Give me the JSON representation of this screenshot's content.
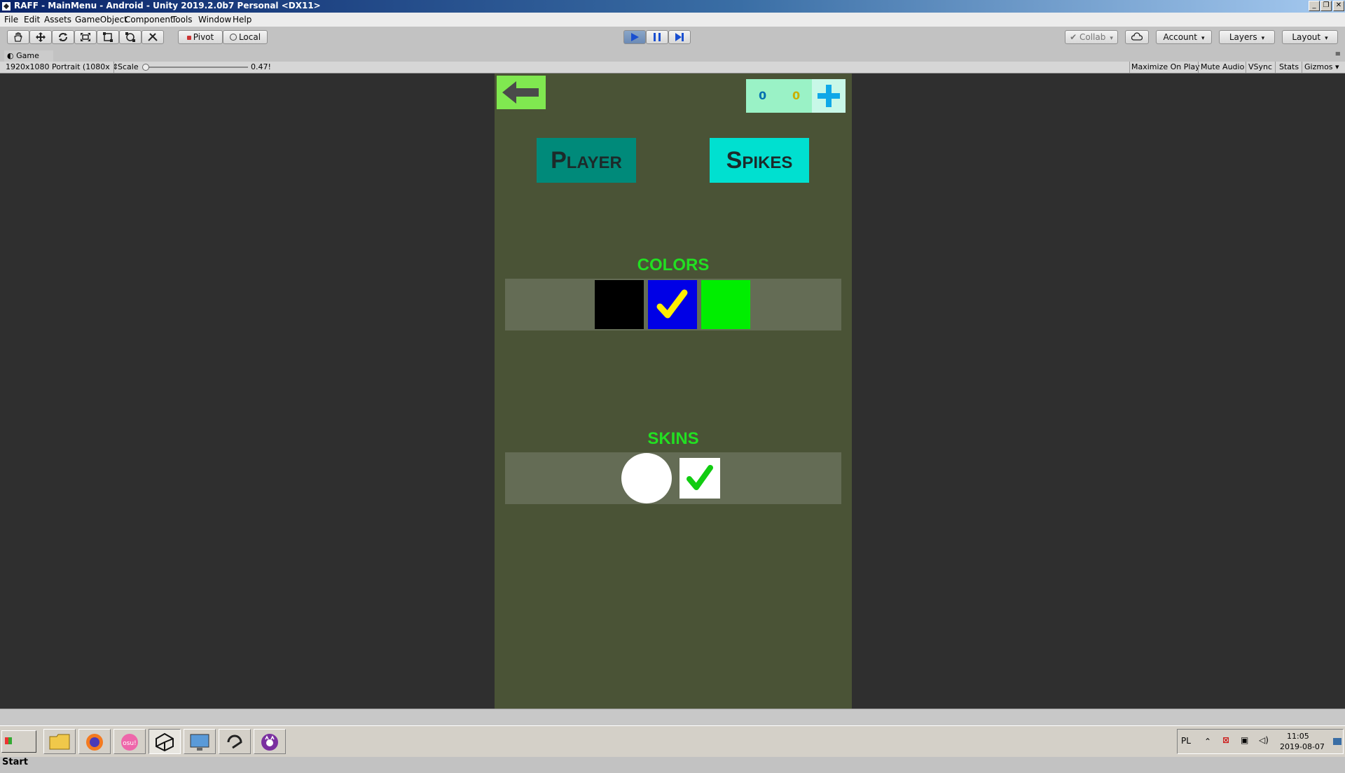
{
  "window": {
    "title": "RAFF - MainMenu - Android - Unity 2019.2.0b7 Personal <DX11>"
  },
  "menu": [
    "File",
    "Edit",
    "Assets",
    "GameObject",
    "Component",
    "Tools",
    "Window",
    "Help"
  ],
  "toolbar": {
    "pivot_label": "Pivot",
    "local_label": "Local",
    "collab_label": "Collab",
    "account_label": "Account",
    "layers_label": "Layers",
    "layout_label": "Layout"
  },
  "game_tab": {
    "label": "Game",
    "resolution": "1920x1080 Portrait (1080x",
    "scale_label": "Scale",
    "scale_value": "0.47!",
    "scale_slider_level": 0.02,
    "maximize_label": "Maximize On Play",
    "mute_label": "Mute Audio",
    "vsync_label": "VSync",
    "stats_label": "Stats",
    "gizmos_label": "Gizmos"
  },
  "game": {
    "counter_a": "0",
    "counter_b": "0",
    "player_button": "Player",
    "spikes_button": "Spikes",
    "colors_title": "COLORS",
    "skins_title": "SKINS",
    "colors": [
      {
        "name": "black",
        "hex": "#000000",
        "selected": false
      },
      {
        "name": "blue",
        "hex": "#0000e6",
        "selected": true
      },
      {
        "name": "green",
        "hex": "#00ee00",
        "selected": false
      }
    ],
    "accent_colors": {
      "back_button": "#80e850",
      "counter_bg": "#9af2c6",
      "player_button": "#008a7a",
      "spikes_button": "#00e0d0",
      "title_green": "#22e022"
    }
  },
  "taskbar": {
    "start_label": "Start",
    "apps": [
      "file-explorer",
      "firefox",
      "osu",
      "unity",
      "remote-desktop",
      "app-6",
      "app-7"
    ],
    "lang": "PL",
    "time": "11:05",
    "date": "2019-08-07"
  }
}
